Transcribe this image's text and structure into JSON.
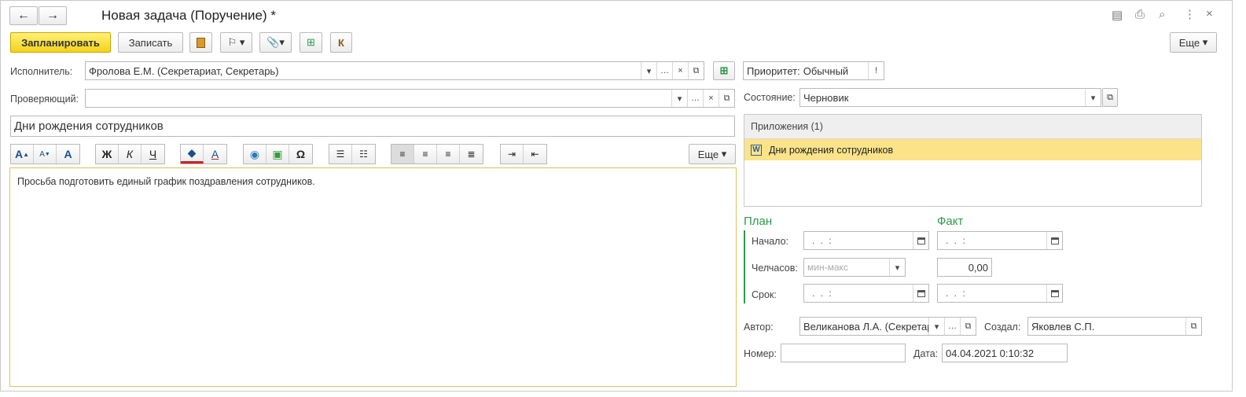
{
  "window": {
    "title": "Новая задача (Поручение) *",
    "nav_back": "←",
    "nav_forward": "→"
  },
  "toolbar": {
    "plan_label": "Запланировать",
    "save_label": "Записать",
    "k_label": "К",
    "more_label": "Еще"
  },
  "form": {
    "executor_label": "Исполнитель:",
    "executor_value": "Фролова Е.М. (Секретариат, Секретарь)",
    "reviewer_label": "Проверяющий:",
    "reviewer_value": "",
    "subject_value": "Дни рождения сотрудников",
    "editor_more_label": "Еще",
    "body_text": "Просьба подготовить единый график поздравления сотрудников."
  },
  "side": {
    "priority_label": "Приоритет:",
    "priority_value": "Обычный",
    "state_label": "Состояние:",
    "state_value": "Черновик",
    "attachments_header": "Приложения (1)",
    "attachments": [
      {
        "name": "Дни рождения сотрудников"
      }
    ],
    "plan_title": "План",
    "fact_title": "Факт",
    "start_label": "Начало:",
    "hours_label": "Челчасов:",
    "deadline_label": "Срок:",
    "date_mask": ".  .      :",
    "hours_placeholder": "мин-макс",
    "fact_hours_value": "0,00",
    "author_label": "Автор:",
    "author_value": "Великанова Л.А. (Секретари",
    "creator_label": "Создал:",
    "creator_value": "Яковлев С.П.",
    "number_label": "Номер:",
    "number_value": "",
    "date_label": "Дата:",
    "date_value": "04.04.2021  0:10:32"
  },
  "editor_toolbar": {
    "bold": "Ж",
    "italic": "К",
    "underline": "Ч",
    "font_a": "A",
    "omega": "Ω"
  },
  "colors": {
    "accent_yellow": "#f3d21a",
    "selection_yellow": "#fbe38a",
    "green": "#2e9a4a",
    "border": "#b9b9b9"
  }
}
